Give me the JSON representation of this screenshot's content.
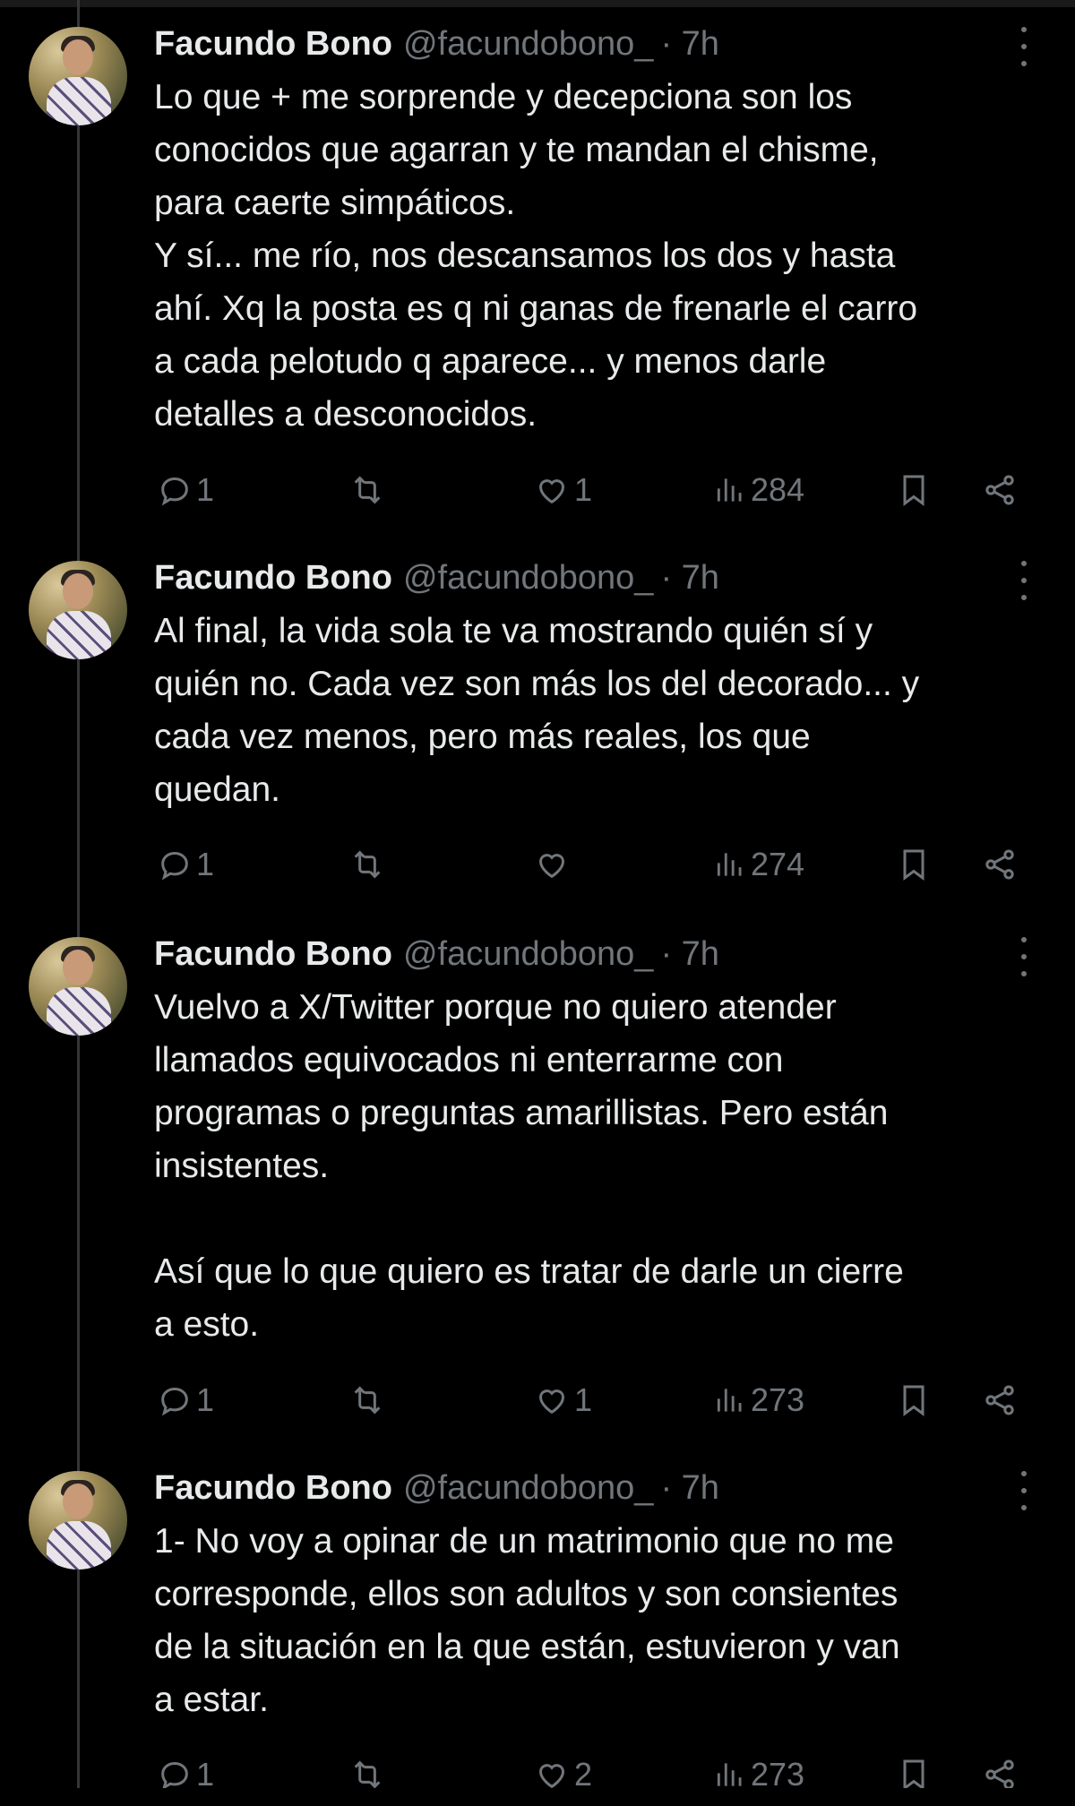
{
  "tweets": [
    {
      "name": "Facundo Bono",
      "handle": "@facundobono_",
      "time": "· 7h",
      "text": "Lo que + me sorprende y decepciona son los\nconocidos que agarran y te mandan el chisme,\npara caerte simpáticos.\nY sí... me río, nos descansamos los dos y hasta\nahí. Xq la posta es q ni ganas de frenarle el carro\na cada pelotudo q aparece... y menos darle\ndetalles a desconocidos.",
      "replies": "1",
      "reposts": "",
      "likes": "1",
      "views": "284"
    },
    {
      "name": "Facundo Bono",
      "handle": "@facundobono_",
      "time": "· 7h",
      "text": "Al final, la vida sola te va mostrando quién sí y\nquién no. Cada vez son más los del decorado... y\ncada vez menos, pero más reales, los que\nquedan.",
      "replies": "1",
      "reposts": "",
      "likes": "",
      "views": "274"
    },
    {
      "name": "Facundo Bono",
      "handle": "@facundobono_",
      "time": "· 7h",
      "text": "Vuelvo a X/Twitter porque no quiero atender\nllamados equivocados ni enterrarme con\nprogramas o preguntas amarillistas. Pero están\ninsistentes.\n\nAsí que lo que quiero es tratar de darle un cierre\na esto.",
      "replies": "1",
      "reposts": "",
      "likes": "1",
      "views": "273"
    },
    {
      "name": "Facundo Bono",
      "handle": "@facundobono_",
      "time": "· 7h",
      "text": "1- No voy a opinar de un matrimonio que no me\ncorresponde, ellos son adultos y son consientes\nde la situación en la que están, estuvieron y van\na estar.",
      "replies": "1",
      "reposts": "",
      "likes": "2",
      "views": "273"
    }
  ],
  "icons": {
    "reply": "reply-icon",
    "repost": "repost-icon",
    "like": "heart-icon",
    "views": "views-icon",
    "bookmark": "bookmark-icon",
    "share": "share-icon",
    "more": "more-icon"
  },
  "colors": {
    "background": "#000000",
    "text": "#e7e9ea",
    "muted": "#71767b",
    "thread_line": "#333639"
  }
}
